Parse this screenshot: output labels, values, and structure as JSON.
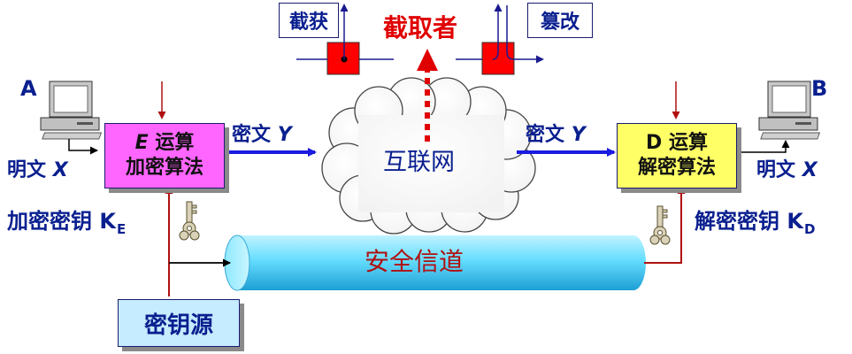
{
  "attacker": {
    "title": "截取者",
    "intercept_label": "截获",
    "tamper_label": "篡改"
  },
  "sender": {
    "node_label": "A",
    "plaintext_label": "明文",
    "plaintext_var": "X",
    "algorithm_line1_var": "E",
    "algorithm_line1_text": "运算",
    "algorithm_line2": "加密算法",
    "key_label": "加密密钥 K",
    "key_subscript": "E"
  },
  "receiver": {
    "node_label": "B",
    "plaintext_label": "明文",
    "plaintext_var": "X",
    "algorithm_line1_var": "D",
    "algorithm_line1_text": "运算",
    "algorithm_line2": "解密算法",
    "key_label": "解密密钥 K",
    "key_subscript": "D"
  },
  "channel": {
    "ciphertext_label": "密文",
    "ciphertext_var": "Y",
    "network_label": "互联网",
    "secure_channel_label": "安全信道"
  },
  "key_source": {
    "label": "密钥源"
  },
  "colors": {
    "text_blue": "#0a1f8f",
    "attacker_red": "#e00000",
    "dark_red": "#b01010",
    "flow_blue": "#1a1ae0",
    "encrypt_box": "#ff66ff",
    "decrypt_box": "#ffff66",
    "key_source_box": "#c6ecff",
    "pipe": "#66ddff"
  },
  "icons": [
    "computer-icon",
    "key-icon",
    "cloud-icon",
    "pipe-icon"
  ]
}
